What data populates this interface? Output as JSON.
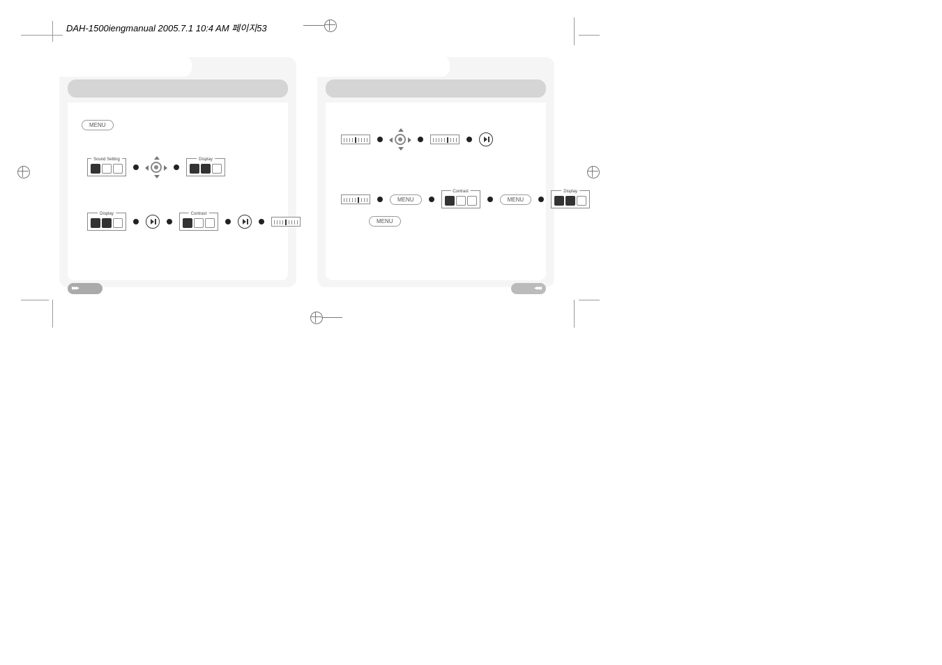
{
  "header": "DAH-1500iengmanual  2005.7.1 10:4 AM  페이지53",
  "labels": {
    "menu": "MENU",
    "sound_setting": "Sound Setting",
    "display": "Display",
    "contrast": "Contrast"
  },
  "nav": {
    "left_arrows": "◂◂◂",
    "right_arrows": "▸▸▸"
  }
}
